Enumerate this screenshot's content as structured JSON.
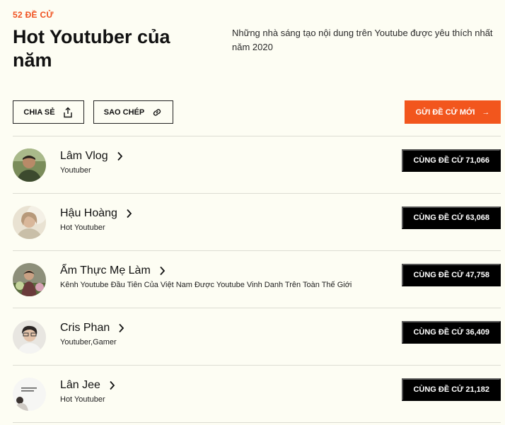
{
  "header": {
    "count_label": "52 ĐỀ CỬ",
    "title": "Hot Youtuber của năm",
    "description": "Những nhà sáng tạo nội dung trên Youtube được yêu thích nhất năm 2020"
  },
  "actions": {
    "share_label": "CHIA SẺ",
    "copy_label": "SAO CHÉP",
    "new_label": "GỬI ĐỀ CỬ MỚI",
    "new_arrow": "→"
  },
  "accent_color": "#f2561d",
  "nominees": [
    {
      "name": "Lâm Vlog",
      "subtitle": "Youtuber",
      "vote_label": "CÙNG ĐỀ CỬ 71,066"
    },
    {
      "name": "Hậu Hoàng",
      "subtitle": "Hot Youtuber",
      "vote_label": "CÙNG ĐỀ CỬ 63,068"
    },
    {
      "name": "Ẩm Thực Mẹ Làm",
      "subtitle": "Kênh Youtube Đầu Tiên Của Việt Nam Được Youtube Vinh Danh Trên Toàn Thế Giới",
      "vote_label": "CÙNG ĐỀ CỬ 47,758"
    },
    {
      "name": "Cris Phan",
      "subtitle": "Youtuber,Gamer",
      "vote_label": "CÙNG ĐỀ CỬ 36,409"
    },
    {
      "name": "Lân Jee",
      "subtitle": "Hot Youtuber",
      "vote_label": "CÙNG ĐỀ CỬ 21,182"
    }
  ]
}
